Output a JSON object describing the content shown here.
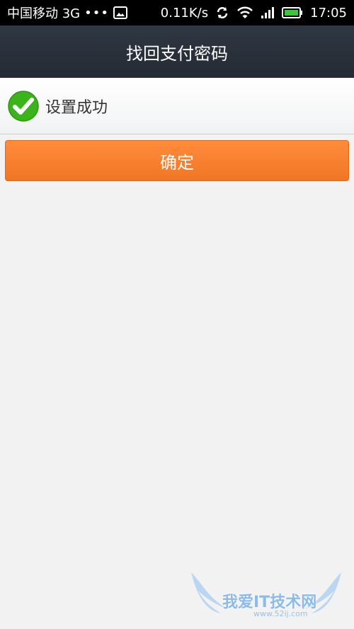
{
  "status_bar": {
    "carrier": "中国移动 3G",
    "notification_dots": "•••",
    "network_speed": "0.11K/s",
    "time": "17:05",
    "icons": [
      "image-icon",
      "sync-icon",
      "wifi-icon",
      "signal-icon",
      "battery-icon"
    ]
  },
  "header": {
    "title": "找回支付密码"
  },
  "result": {
    "message": "设置成功",
    "icon": "check-circle-icon",
    "icon_color": "#3bb31a"
  },
  "actions": {
    "confirm_label": "确定",
    "confirm_color": "#f7802f"
  },
  "watermark": {
    "text": "我爱IT技术网",
    "url": "www.52ij.com"
  }
}
